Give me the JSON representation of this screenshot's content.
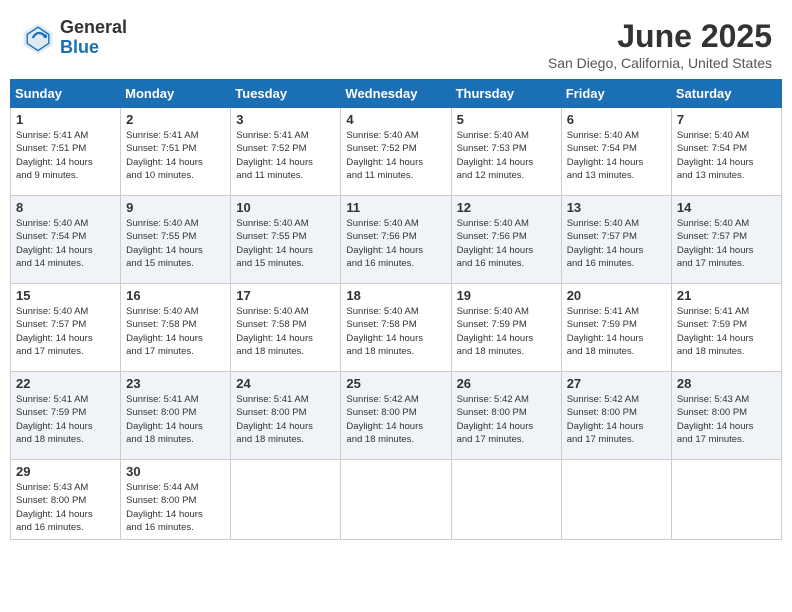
{
  "header": {
    "logo_general": "General",
    "logo_blue": "Blue",
    "title": "June 2025",
    "subtitle": "San Diego, California, United States"
  },
  "weekdays": [
    "Sunday",
    "Monday",
    "Tuesday",
    "Wednesday",
    "Thursday",
    "Friday",
    "Saturday"
  ],
  "weeks": [
    [
      {
        "day": "1",
        "info": "Sunrise: 5:41 AM\nSunset: 7:51 PM\nDaylight: 14 hours\nand 9 minutes."
      },
      {
        "day": "2",
        "info": "Sunrise: 5:41 AM\nSunset: 7:51 PM\nDaylight: 14 hours\nand 10 minutes."
      },
      {
        "day": "3",
        "info": "Sunrise: 5:41 AM\nSunset: 7:52 PM\nDaylight: 14 hours\nand 11 minutes."
      },
      {
        "day": "4",
        "info": "Sunrise: 5:40 AM\nSunset: 7:52 PM\nDaylight: 14 hours\nand 11 minutes."
      },
      {
        "day": "5",
        "info": "Sunrise: 5:40 AM\nSunset: 7:53 PM\nDaylight: 14 hours\nand 12 minutes."
      },
      {
        "day": "6",
        "info": "Sunrise: 5:40 AM\nSunset: 7:54 PM\nDaylight: 14 hours\nand 13 minutes."
      },
      {
        "day": "7",
        "info": "Sunrise: 5:40 AM\nSunset: 7:54 PM\nDaylight: 14 hours\nand 13 minutes."
      }
    ],
    [
      {
        "day": "8",
        "info": "Sunrise: 5:40 AM\nSunset: 7:54 PM\nDaylight: 14 hours\nand 14 minutes."
      },
      {
        "day": "9",
        "info": "Sunrise: 5:40 AM\nSunset: 7:55 PM\nDaylight: 14 hours\nand 15 minutes."
      },
      {
        "day": "10",
        "info": "Sunrise: 5:40 AM\nSunset: 7:55 PM\nDaylight: 14 hours\nand 15 minutes."
      },
      {
        "day": "11",
        "info": "Sunrise: 5:40 AM\nSunset: 7:56 PM\nDaylight: 14 hours\nand 16 minutes."
      },
      {
        "day": "12",
        "info": "Sunrise: 5:40 AM\nSunset: 7:56 PM\nDaylight: 14 hours\nand 16 minutes."
      },
      {
        "day": "13",
        "info": "Sunrise: 5:40 AM\nSunset: 7:57 PM\nDaylight: 14 hours\nand 16 minutes."
      },
      {
        "day": "14",
        "info": "Sunrise: 5:40 AM\nSunset: 7:57 PM\nDaylight: 14 hours\nand 17 minutes."
      }
    ],
    [
      {
        "day": "15",
        "info": "Sunrise: 5:40 AM\nSunset: 7:57 PM\nDaylight: 14 hours\nand 17 minutes."
      },
      {
        "day": "16",
        "info": "Sunrise: 5:40 AM\nSunset: 7:58 PM\nDaylight: 14 hours\nand 17 minutes."
      },
      {
        "day": "17",
        "info": "Sunrise: 5:40 AM\nSunset: 7:58 PM\nDaylight: 14 hours\nand 18 minutes."
      },
      {
        "day": "18",
        "info": "Sunrise: 5:40 AM\nSunset: 7:58 PM\nDaylight: 14 hours\nand 18 minutes."
      },
      {
        "day": "19",
        "info": "Sunrise: 5:40 AM\nSunset: 7:59 PM\nDaylight: 14 hours\nand 18 minutes."
      },
      {
        "day": "20",
        "info": "Sunrise: 5:41 AM\nSunset: 7:59 PM\nDaylight: 14 hours\nand 18 minutes."
      },
      {
        "day": "21",
        "info": "Sunrise: 5:41 AM\nSunset: 7:59 PM\nDaylight: 14 hours\nand 18 minutes."
      }
    ],
    [
      {
        "day": "22",
        "info": "Sunrise: 5:41 AM\nSunset: 7:59 PM\nDaylight: 14 hours\nand 18 minutes."
      },
      {
        "day": "23",
        "info": "Sunrise: 5:41 AM\nSunset: 8:00 PM\nDaylight: 14 hours\nand 18 minutes."
      },
      {
        "day": "24",
        "info": "Sunrise: 5:41 AM\nSunset: 8:00 PM\nDaylight: 14 hours\nand 18 minutes."
      },
      {
        "day": "25",
        "info": "Sunrise: 5:42 AM\nSunset: 8:00 PM\nDaylight: 14 hours\nand 18 minutes."
      },
      {
        "day": "26",
        "info": "Sunrise: 5:42 AM\nSunset: 8:00 PM\nDaylight: 14 hours\nand 17 minutes."
      },
      {
        "day": "27",
        "info": "Sunrise: 5:42 AM\nSunset: 8:00 PM\nDaylight: 14 hours\nand 17 minutes."
      },
      {
        "day": "28",
        "info": "Sunrise: 5:43 AM\nSunset: 8:00 PM\nDaylight: 14 hours\nand 17 minutes."
      }
    ],
    [
      {
        "day": "29",
        "info": "Sunrise: 5:43 AM\nSunset: 8:00 PM\nDaylight: 14 hours\nand 16 minutes."
      },
      {
        "day": "30",
        "info": "Sunrise: 5:44 AM\nSunset: 8:00 PM\nDaylight: 14 hours\nand 16 minutes."
      },
      {
        "day": "",
        "info": ""
      },
      {
        "day": "",
        "info": ""
      },
      {
        "day": "",
        "info": ""
      },
      {
        "day": "",
        "info": ""
      },
      {
        "day": "",
        "info": ""
      }
    ]
  ]
}
